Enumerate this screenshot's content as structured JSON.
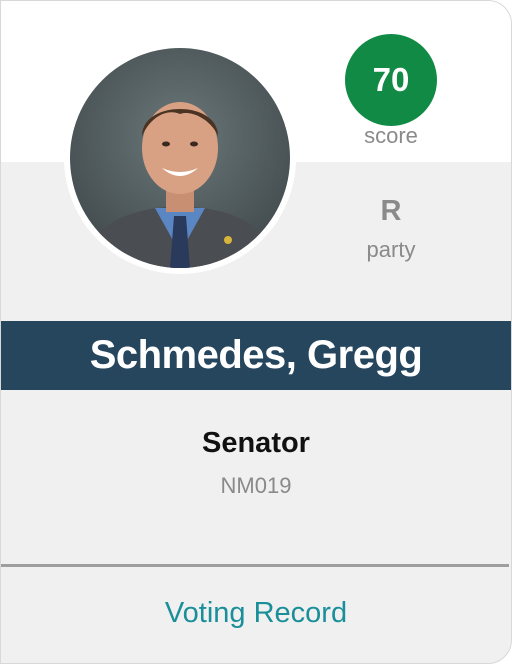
{
  "card": {
    "score": "70",
    "score_label": "score",
    "party": "R",
    "party_label": "party",
    "name": "Schmedes, Gregg",
    "title": "Senator",
    "district": "NM019",
    "voting_link": "Voting Record"
  },
  "colors": {
    "score_badge": "#118a45",
    "name_bar": "#26465e",
    "link": "#1a8f9a"
  },
  "icons": {
    "photo": "portrait-photo"
  }
}
